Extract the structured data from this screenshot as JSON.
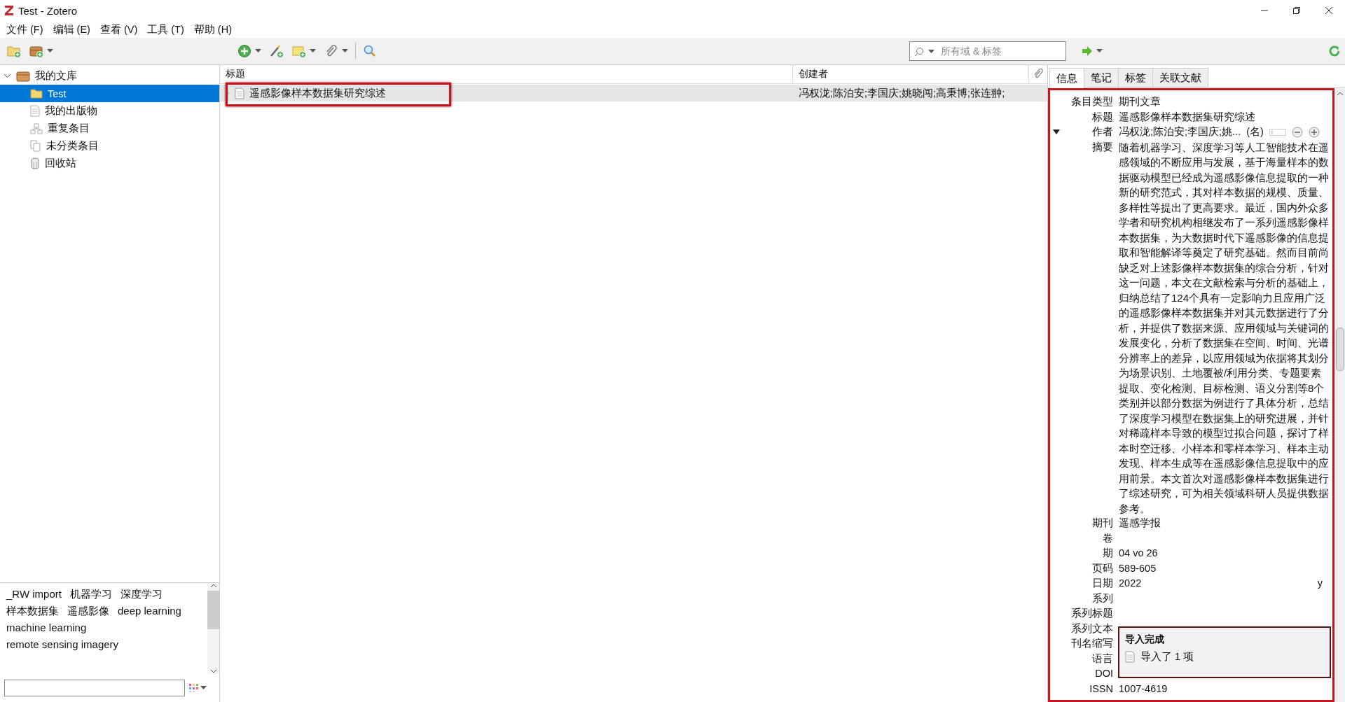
{
  "window": {
    "title": "Test - Zotero"
  },
  "menu": [
    {
      "label": "文件 (F)"
    },
    {
      "label": "编辑 (E)"
    },
    {
      "label": "查看 (V)"
    },
    {
      "label": "工具 (T)"
    },
    {
      "label": "帮助 (H)"
    }
  ],
  "search": {
    "placeholder": "所有域 & 标签"
  },
  "collections": [
    {
      "label": "我的文库",
      "kind": "library",
      "expanded": true,
      "selected": false,
      "children": [
        {
          "label": "Test",
          "kind": "folder",
          "selected": true
        },
        {
          "label": "我的出版物",
          "kind": "publications",
          "selected": false
        },
        {
          "label": "重复条目",
          "kind": "duplicates",
          "selected": false
        },
        {
          "label": "未分类条目",
          "kind": "unfiled",
          "selected": false
        },
        {
          "label": "回收站",
          "kind": "trash",
          "selected": false
        }
      ]
    }
  ],
  "tags": [
    "_RW import",
    "机器学习",
    "深度学习",
    "样本数据集",
    "遥感影像",
    "deep learning",
    "machine learning",
    "remote sensing imagery"
  ],
  "items": {
    "columns": [
      "标题",
      "创建者"
    ],
    "rows": [
      {
        "title": "遥感影像样本数据集研究综述",
        "creators": "冯权泷;陈泊安;李国庆;姚晓闯;高秉博;张连翀;",
        "selected": true,
        "highlighted": true
      }
    ]
  },
  "item_pane": {
    "highlighted": true,
    "tabs": [
      {
        "label": "信息",
        "selected": true
      },
      {
        "label": "笔记",
        "selected": false
      },
      {
        "label": "标签",
        "selected": false
      },
      {
        "label": "关联文献",
        "selected": false
      }
    ],
    "fields": [
      {
        "kind": "text",
        "label": "条目类型",
        "value": "期刊文章"
      },
      {
        "kind": "text",
        "label": "标题",
        "value": "遥感影像样本数据集研究综述"
      },
      {
        "kind": "creator",
        "label": "作者",
        "value": "冯权泷;陈泊安;李国庆;姚...",
        "name_mode": "(名)",
        "expanded": true
      },
      {
        "kind": "abstract",
        "label": "摘要",
        "value": "随着机器学习、深度学习等人工智能技术在遥感领域的不断应用与发展，基于海量样本的数据驱动模型已经成为遥感影像信息提取的一种新的研究范式，其对样本数据的规模、质量、多样性等提出了更高要求。最近，国内外众多学者和研究机构相继发布了一系列遥感影像样本数据集，为大数据时代下遥感影像的信息提取和智能解译等奠定了研究基础。然而目前尚缺乏对上述影像样本数据集的综合分析，针对这一问题，本文在文献检索与分析的基础上，归纳总结了124个具有一定影响力且应用广泛的遥感影像样本数据集并对其元数据进行了分析，并提供了数据来源、应用领域与关键词的发展变化，分析了数据集在空间、时间、光谱分辨率上的差异，以应用领域为依据将其划分为场景识别、土地覆被/利用分类、专题要素提取、变化检测、目标检测、语义分割等8个类别并以部分数据为例进行了具体分析，总结了深度学习模型在数据集上的研究进展，并针对稀疏样本导致的模型过拟合问题，探讨了样本时空迁移、小样本和零样本学习、样本主动发现、样本生成等在遥感影像信息提取中的应用前景。本文首次对遥感影像样本数据集进行了综述研究，可为相关领域科研人员提供数据参考。"
      },
      {
        "kind": "text",
        "label": "期刊",
        "value": "遥感学报"
      },
      {
        "kind": "text",
        "label": "卷"
      },
      {
        "kind": "text",
        "label": "期",
        "value": "04 vo 26"
      },
      {
        "kind": "text",
        "label": "页码",
        "value": "589-605"
      },
      {
        "kind": "date",
        "label": "日期",
        "value": "2022",
        "hint": "y"
      },
      {
        "kind": "text",
        "label": "系列"
      },
      {
        "kind": "text",
        "label": "系列标题"
      },
      {
        "kind": "text",
        "label": "系列文本"
      },
      {
        "kind": "text",
        "label": "刊名缩写"
      },
      {
        "kind": "text",
        "label": "语言"
      },
      {
        "kind": "text",
        "label": "DOI"
      },
      {
        "kind": "text",
        "label": "ISSN",
        "value": "1007-4619"
      }
    ]
  },
  "notification": {
    "title": "导入完成",
    "message": "导入了 1 项"
  }
}
